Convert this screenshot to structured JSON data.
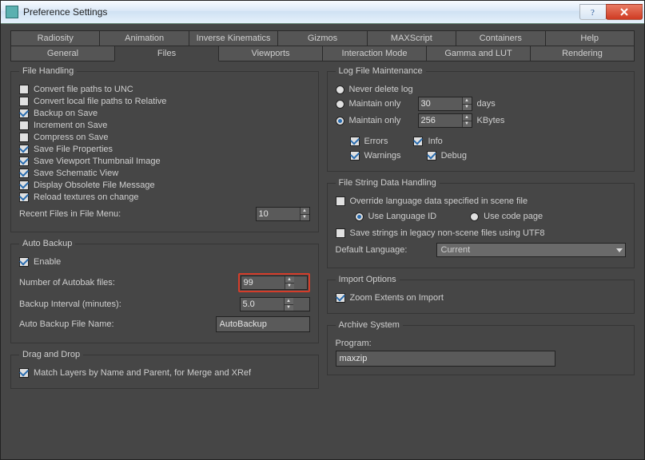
{
  "window": {
    "title": "Preference Settings"
  },
  "tabs_row1": [
    "Radiosity",
    "Animation",
    "Inverse Kinematics",
    "Gizmos",
    "MAXScript",
    "Containers",
    "Help"
  ],
  "tabs_row2": [
    "General",
    "Files",
    "Viewports",
    "Interaction Mode",
    "Gamma and LUT",
    "Rendering"
  ],
  "active_tab": "Files",
  "file_handling": {
    "legend": "File Handling",
    "opts": [
      {
        "label": "Convert file paths to UNC",
        "checked": false
      },
      {
        "label": "Convert local file paths to Relative",
        "checked": false
      },
      {
        "label": "Backup on Save",
        "checked": true
      },
      {
        "label": "Increment on Save",
        "checked": false
      },
      {
        "label": "Compress on Save",
        "checked": false
      },
      {
        "label": "Save File Properties",
        "checked": true
      },
      {
        "label": "Save Viewport Thumbnail Image",
        "checked": true
      },
      {
        "label": "Save Schematic View",
        "checked": true
      },
      {
        "label": "Display Obsolete File Message",
        "checked": true
      },
      {
        "label": "Reload textures on change",
        "checked": true
      }
    ],
    "recent_label": "Recent Files in File Menu:",
    "recent_value": "10"
  },
  "auto_backup": {
    "legend": "Auto Backup",
    "enable_label": "Enable",
    "enable_checked": true,
    "num_label": "Number of Autobak files:",
    "num_value": "99",
    "interval_label": "Backup Interval (minutes):",
    "interval_value": "5.0",
    "name_label": "Auto Backup File Name:",
    "name_value": "AutoBackup"
  },
  "drag_drop": {
    "legend": "Drag and Drop",
    "match_label": "Match Layers by Name and Parent, for Merge and XRef",
    "match_checked": true
  },
  "log_maint": {
    "legend": "Log File Maintenance",
    "never_label": "Never delete log",
    "maintain_days_label": "Maintain only",
    "days_value": "30",
    "days_unit": "days",
    "maintain_kb_label": "Maintain only",
    "kb_value": "256",
    "kb_unit": "KBytes",
    "selected": "kb",
    "flags": {
      "errors": {
        "label": "Errors",
        "checked": true
      },
      "info": {
        "label": "Info",
        "checked": true
      },
      "warnings": {
        "label": "Warnings",
        "checked": true
      },
      "debug": {
        "label": "Debug",
        "checked": true
      }
    }
  },
  "string_handling": {
    "legend": "File String Data Handling",
    "override_label": "Override language data specified in scene file",
    "override_checked": false,
    "use_lang_label": "Use Language ID",
    "use_codepage_label": "Use code page",
    "lang_selected": "id",
    "utf8_label": "Save strings in legacy non-scene files using UTF8",
    "utf8_checked": false,
    "default_lang_label": "Default Language:",
    "default_lang_value": "Current"
  },
  "import_opts": {
    "legend": "Import Options",
    "zoom_label": "Zoom Extents on Import",
    "zoom_checked": true
  },
  "archive": {
    "legend": "Archive System",
    "program_label": "Program:",
    "program_value": "maxzip"
  }
}
